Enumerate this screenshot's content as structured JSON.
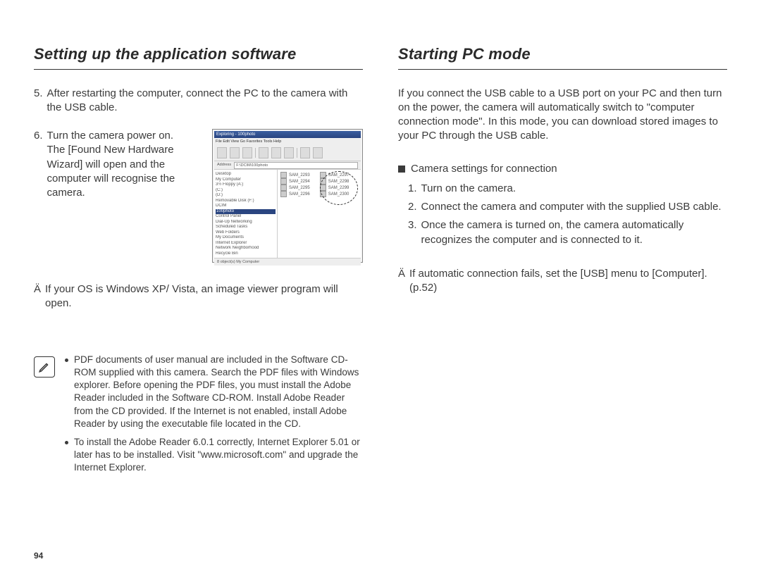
{
  "page_number": "94",
  "left": {
    "title": "Setting up the application software",
    "step5_num": " 5.",
    "step5_body": "After restarting the computer, connect the PC to the camera with the USB cable.",
    "step6_num": " 6.",
    "step6_body": "Turn the camera power on.\nThe [Found New Hardware Wizard] will open and the computer will recognise the camera.",
    "xp_note_mark": "Ä",
    "xp_note_body": "If your OS is Windows XP/ Vista, an image viewer program will open.",
    "info_bullet1": "PDF documents of user manual are included in the Software CD-ROM supplied with this camera. Search the PDF files with Windows explorer. Before opening the PDF files, you must install the Adobe Reader included in the Software CD-ROM. Install Adobe Reader from the CD provided. If the Internet is not enabled, install Adobe Reader by using the executable file located in the CD.",
    "info_bullet2": "To install the Adobe Reader 6.0.1 correctly, Internet Explorer 5.01 or later has to be installed. Visit \"www.microsoft.com\" and upgrade the Internet Explorer."
  },
  "right": {
    "title": "Starting PC mode",
    "intro": "If you connect the USB cable to a USB port on your PC and then turn on the power, the camera will automatically switch to \"computer connection mode\". In this mode, you can download stored images to your PC through the USB cable.",
    "subheading": "Camera settings for connection",
    "item1_num": " 1.",
    "item1_body": "Turn on the camera.",
    "item2_num": " 2.",
    "item2_body": "Connect the camera and computer with the supplied USB cable.",
    "item3_num": " 3.",
    "item3_body": "Once the camera is turned on, the camera automatically recognizes the computer and is connected to it.",
    "auto_mark": "Ä",
    "auto_body": "If automatic connection fails, set the [USB] menu to [Computer]. (p.52)"
  },
  "shot": {
    "title": "Exploring - 100photo",
    "menu": "File  Edit  View  Go  Favorites  Tools  Help",
    "addr_label": "Address",
    "addr_value": "F:\\DCIM\\100photo",
    "tree": [
      "Desktop",
      "  My Computer",
      "    3½ Floppy (A:)",
      "    (C:)",
      "    (D:)",
      "    Removable Disk (F:)",
      "      DCIM",
      "        100photo",
      "    Control Panel",
      "    Dial-Up Networking",
      "    Scheduled Tasks",
      "    Web Folders",
      "  My Documents",
      "  Internet Explorer",
      "  Network Neighborhood",
      "  Recycle Bin"
    ],
    "files_left": [
      "SAM_2293",
      "SAM_2294",
      "SAM_2295",
      "SAM_2296"
    ],
    "files_right": [
      "SAM_2297",
      "SAM_2298",
      "SAM_2299",
      "SAM_2300"
    ],
    "status": "8 object(s)   My Computer"
  }
}
